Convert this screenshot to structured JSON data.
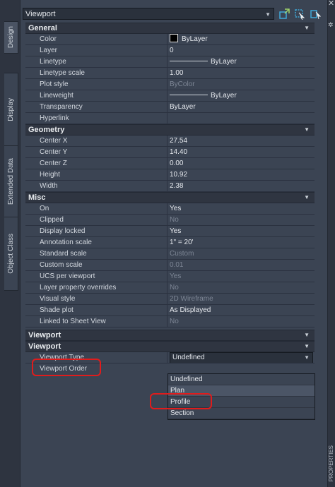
{
  "side_tabs": [
    {
      "label": "Design"
    },
    {
      "label": "Display"
    },
    {
      "label": "Extended Data"
    },
    {
      "label": "Object Class"
    }
  ],
  "toolbar": {
    "selection": "Viewport",
    "buttons": [
      {
        "icon": "quick-select-icon"
      },
      {
        "icon": "select-objects-icon"
      },
      {
        "icon": "toggle-pickadd-icon"
      }
    ]
  },
  "right_strip": {
    "close_glyph": "✕",
    "settings_glyph": "✲",
    "title": "PROPERTIES"
  },
  "sections": [
    {
      "title": "General",
      "rows": [
        {
          "label": "Color",
          "value": "ByLayer",
          "kind": "swatch"
        },
        {
          "label": "Layer",
          "value": "0"
        },
        {
          "label": "Linetype",
          "value": "ByLayer",
          "kind": "line"
        },
        {
          "label": "Linetype scale",
          "value": "1.00"
        },
        {
          "label": "Plot style",
          "value": "ByColor",
          "dim": true
        },
        {
          "label": "Lineweight",
          "value": "ByLayer",
          "kind": "line"
        },
        {
          "label": "Transparency",
          "value": "ByLayer"
        },
        {
          "label": "Hyperlink",
          "value": ""
        }
      ]
    },
    {
      "title": "Geometry",
      "rows": [
        {
          "label": "Center X",
          "value": "27.54"
        },
        {
          "label": "Center Y",
          "value": "14.40"
        },
        {
          "label": "Center Z",
          "value": "0.00"
        },
        {
          "label": "Height",
          "value": "10.92"
        },
        {
          "label": "Width",
          "value": "2.38"
        }
      ]
    },
    {
      "title": "Misc",
      "rows": [
        {
          "label": "On",
          "value": "Yes"
        },
        {
          "label": "Clipped",
          "value": "No",
          "dim": true
        },
        {
          "label": "Display locked",
          "value": "Yes"
        },
        {
          "label": "Annotation scale",
          "value": "1\" = 20'"
        },
        {
          "label": "Standard scale",
          "value": "Custom",
          "dim": true
        },
        {
          "label": "Custom scale",
          "value": "0.01",
          "dim": true
        },
        {
          "label": "UCS per viewport",
          "value": "Yes",
          "dim": true
        },
        {
          "label": "Layer property overrides",
          "value": "No",
          "dim": true
        },
        {
          "label": "Visual style",
          "value": "2D Wireframe",
          "dim": true
        },
        {
          "label": "Shade plot",
          "value": "As Displayed"
        },
        {
          "label": "Linked to Sheet View",
          "value": "No",
          "dim": true
        }
      ]
    },
    {
      "title": "Viewport",
      "rows": []
    },
    {
      "title": "Viewport",
      "rows": [
        {
          "label": "Viewport Type",
          "value": "Undefined",
          "kind": "dropdown"
        },
        {
          "label": "Viewport Order",
          "value": ""
        }
      ]
    }
  ],
  "dropdown_options": [
    "Undefined",
    "Plan",
    "Profile",
    "Section"
  ],
  "colors": {
    "background": "#3b4453",
    "section": "#2f3541",
    "highlight": "#e01c1c"
  }
}
